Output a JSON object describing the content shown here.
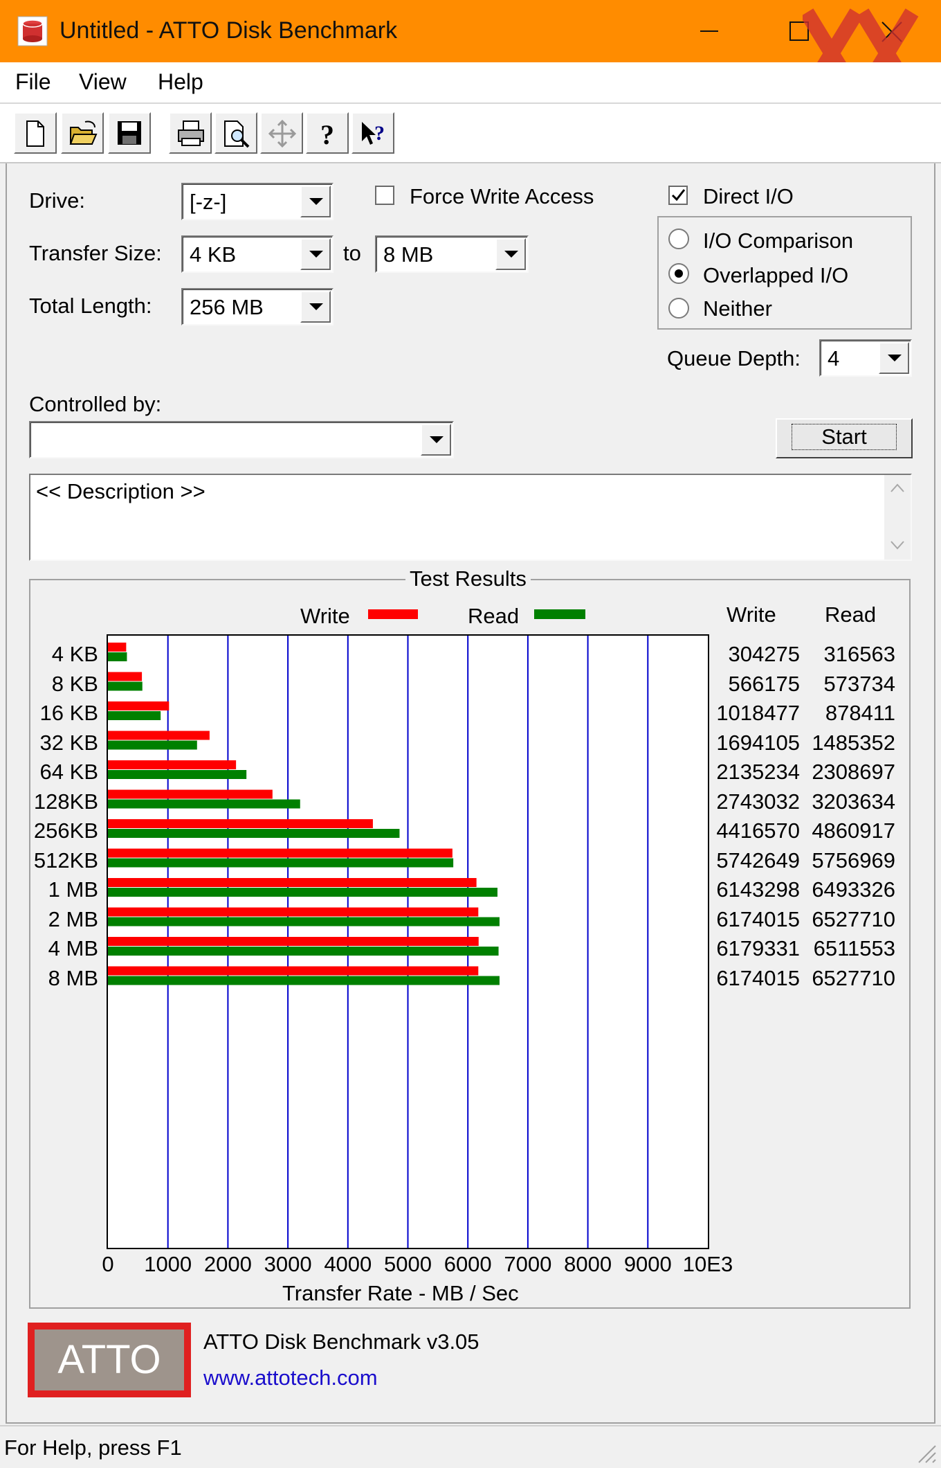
{
  "window": {
    "title": "Untitled - ATTO Disk Benchmark",
    "minimize": "—",
    "maximize": "☐",
    "close": "✕",
    "accent": "#ff8c00"
  },
  "menu": {
    "file": "File",
    "view": "View",
    "help": "Help"
  },
  "toolbar": {
    "icons": [
      "new-file-icon",
      "open-folder-icon",
      "save-icon",
      "print-icon",
      "print-preview-icon",
      "move-icon",
      "help-icon",
      "context-help-icon"
    ]
  },
  "settings": {
    "drive_label": "Drive:",
    "drive_value": "[-z-]",
    "force_write_label": "Force Write Access",
    "force_write_checked": false,
    "direct_io_label": "Direct I/O",
    "direct_io_checked": true,
    "transfer_size_label": "Transfer Size:",
    "transfer_from": "4 KB",
    "to_label": "to",
    "transfer_to": "8 MB",
    "total_length_label": "Total Length:",
    "total_length_value": "256 MB",
    "io_comparison_label": "I/O Comparison",
    "overlapped_io_label": "Overlapped I/O",
    "neither_label": "Neither",
    "selected_io_mode": "Overlapped I/O",
    "queue_depth_label": "Queue Depth:",
    "queue_depth_value": "4",
    "controlled_by_label": "Controlled by:",
    "controlled_by_value": "",
    "start_label": "Start",
    "description": "<< Description >>"
  },
  "results": {
    "group_title": "Test Results",
    "legend_write": "Write",
    "legend_read": "Read",
    "col_write": "Write",
    "col_read": "Read",
    "rows": [
      {
        "size": "4 KB",
        "write": "304275",
        "read": "316563"
      },
      {
        "size": "8 KB",
        "write": "566175",
        "read": "573734"
      },
      {
        "size": "16 KB",
        "write": "1018477",
        "read": "878411"
      },
      {
        "size": "32 KB",
        "write": "1694105",
        "read": "1485352"
      },
      {
        "size": "64 KB",
        "write": "2135234",
        "read": "2308697"
      },
      {
        "size": "128KB",
        "write": "2743032",
        "read": "3203634"
      },
      {
        "size": "256KB",
        "write": "4416570",
        "read": "4860917"
      },
      {
        "size": "512KB",
        "write": "5742649",
        "read": "5756969"
      },
      {
        "size": "1 MB",
        "write": "6143298",
        "read": "6493326"
      },
      {
        "size": "2 MB",
        "write": "6174015",
        "read": "6527710"
      },
      {
        "size": "4 MB",
        "write": "6179331",
        "read": "6511553"
      },
      {
        "size": "8 MB",
        "write": "6174015",
        "read": "6527710"
      }
    ]
  },
  "chart_data": {
    "type": "bar",
    "orientation": "horizontal",
    "categories": [
      "4 KB",
      "8 KB",
      "16 KB",
      "32 KB",
      "64 KB",
      "128KB",
      "256KB",
      "512KB",
      "1 MB",
      "2 MB",
      "4 MB",
      "8 MB"
    ],
    "series": [
      {
        "name": "Write",
        "color": "#ff0000",
        "values": [
          304.275,
          566.175,
          1018.477,
          1694.105,
          2135.234,
          2743.032,
          4416.57,
          5742.649,
          6143.298,
          6174.015,
          6179.331,
          6174.015
        ]
      },
      {
        "name": "Read",
        "color": "#008000",
        "values": [
          316.563,
          573.734,
          878.411,
          1485.352,
          2308.697,
          3203.634,
          4860.917,
          5756.969,
          6493.326,
          6527.71,
          6511.553,
          6527.71
        ]
      }
    ],
    "xlabel": "Transfer Rate - MB / Sec",
    "xlim": [
      0,
      10000
    ],
    "xticks": [
      "0",
      "1000",
      "2000",
      "3000",
      "4000",
      "5000",
      "6000",
      "7000",
      "8000",
      "9000",
      "10E3"
    ],
    "grid_color": "#0000cc",
    "grid": true,
    "legend": "top"
  },
  "footer": {
    "logo_text": "ATTO",
    "product": "ATTO Disk Benchmark v3.05",
    "url": "www.attotech.com",
    "status": "For Help, press F1"
  }
}
